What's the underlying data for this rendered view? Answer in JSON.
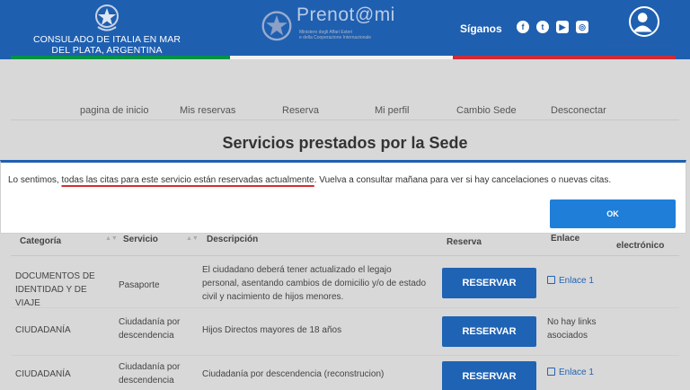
{
  "header": {
    "consulate_line1": "CONSULADO DE ITALIA EN MAR",
    "consulate_line2": "DEL PLATA, ARGENTINA",
    "logo_text": "Prenot@mi",
    "ministry_line1": "Ministero degli Affari Esteri",
    "ministry_line2": "e della Cooperazione Internazionale",
    "follow_label": "Síganos",
    "social": [
      "facebook-icon",
      "twitter-icon",
      "youtube-icon",
      "instagram-icon"
    ]
  },
  "nav": {
    "items": [
      "pagina de inicio",
      "Mis reservas",
      "Reserva",
      "Mi perfil",
      "Cambio Sede",
      "Desconectar"
    ]
  },
  "page_title": "Servicios prestados por la Sede",
  "table": {
    "headers": [
      "Categoría",
      "Servicio",
      "Descripción",
      "Reserva",
      "Enlace",
      "electrónico"
    ],
    "rows": [
      {
        "categoria": "DOCUMENTOS DE IDENTIDAD Y DE VIAJE",
        "servicio": "Pasaporte",
        "descripcion": "El ciudadano deberá tener actualizado el legajo personal, asentando cambios de domicilio y/o de estado civil y nacimiento de hijos menores.",
        "reserva": "RESERVAR",
        "enlace": "Enlace 1"
      },
      {
        "categoria": "CIUDADANÍA",
        "servicio": "Ciudadanía por descendencia",
        "descripcion": "Hijos Directos mayores de 18 años",
        "reserva": "RESERVAR",
        "enlace": "No hay links asociados"
      },
      {
        "categoria": "CIUDADANÍA",
        "servicio": "Ciudadanía por descendencia",
        "descripcion": "Ciudadanía por descendencia (reconstrucion)",
        "reserva": "RESERVAR",
        "enlace": "Enlace 1"
      }
    ]
  },
  "modal": {
    "msg_before": "Lo sentimos, ",
    "msg_highlight": "todas las citas para este servicio están reservadas actualmente",
    "msg_after": ". Vuelva a consultar mañana para ver si hay cancelaciones o nuevas citas.",
    "ok_label": "OK"
  },
  "colors": {
    "header_blue": "#1f5fb0",
    "button_blue": "#1f63b4",
    "ok_blue": "#1f7ed8",
    "flag_green": "#009246",
    "flag_white": "#f1f2f1",
    "flag_red": "#ce2b37"
  }
}
